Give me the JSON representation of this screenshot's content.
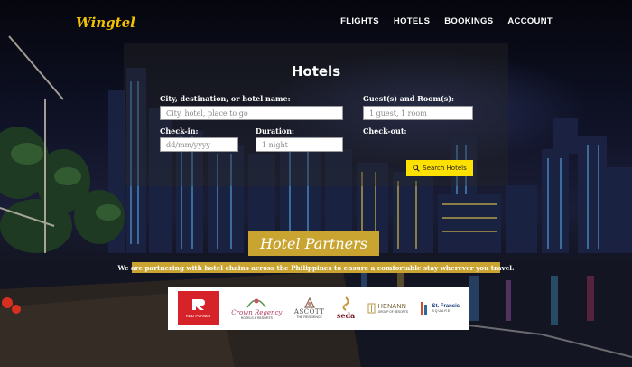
{
  "brand": {
    "logo": "Wingtel"
  },
  "nav": {
    "items": [
      "FLIGHTS",
      "HOTELS",
      "BOOKINGS",
      "ACCOUNT"
    ]
  },
  "search": {
    "title": "Hotels",
    "destination_label": "City, destination, or hotel name:",
    "destination_placeholder": "City, hotel, place to go",
    "guests_label": "Guest(s) and Room(s):",
    "guests_value": "1 guest, 1 room",
    "checkin_label": "Check-in:",
    "checkin_placeholder": "dd/mm/yyyy",
    "duration_label": "Duration:",
    "duration_value": "1 night",
    "checkout_label": "Check-out:",
    "search_button": "Search Hotels"
  },
  "partners": {
    "title": "Hotel Partners",
    "subtitle": "We are partnering with hotel chains across the Philippines to ensure a comfortable stay wherever you travel.",
    "logos": [
      {
        "name": "RED PLANET",
        "color": "#d6232a"
      },
      {
        "name": "Crown Regency",
        "sub": "HOTELS & RESORTS",
        "color": "#b03a5b"
      },
      {
        "name": "ASCOTT",
        "sub": "THE RESIDENCE",
        "color": "#7a6a5a"
      },
      {
        "name": "seda",
        "color": "#7b1f2a"
      },
      {
        "name": "HENANN",
        "sub": "GROUP OF RESORTS",
        "color": "#9a8a4a"
      },
      {
        "name": "St. Francis",
        "sub": "SQUARE",
        "color": "#1a3a7a"
      }
    ]
  },
  "colors": {
    "accent_yellow": "#ffe100",
    "gold_banner": "#c9a431",
    "logo_yellow": "#f2c200"
  }
}
